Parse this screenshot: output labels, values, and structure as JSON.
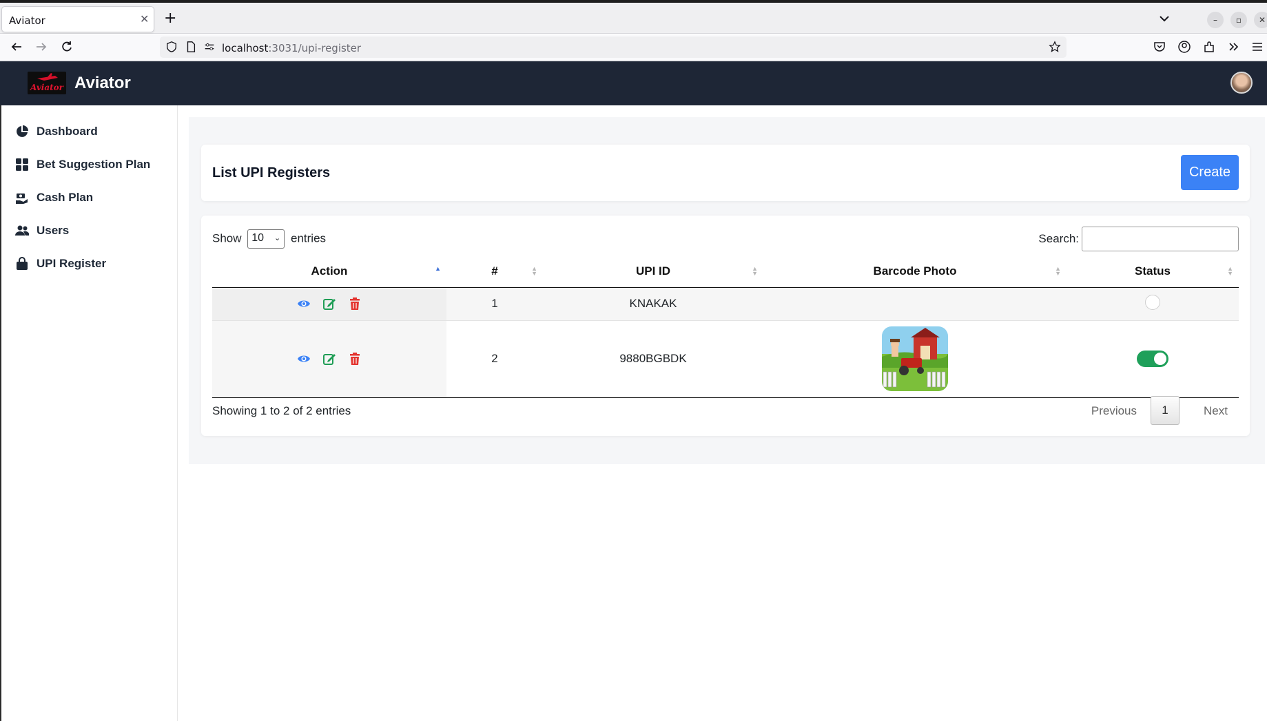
{
  "browser": {
    "tab_title": "Aviator",
    "tab_close": "✕",
    "new_tab": "+",
    "url_host": "localhost",
    "url_path": ":3031/upi-register"
  },
  "app": {
    "title": "Aviator",
    "logo_text": "Aviator"
  },
  "sidebar": {
    "items": [
      {
        "label": "Dashboard",
        "icon": "pie-chart-icon"
      },
      {
        "label": "Bet Suggestion Plan",
        "icon": "grid-icon"
      },
      {
        "label": "Cash Plan",
        "icon": "cash-hand-icon"
      },
      {
        "label": "Users",
        "icon": "users-icon"
      },
      {
        "label": "UPI Register",
        "icon": "bag-icon"
      }
    ]
  },
  "page": {
    "title": "List UPI Registers",
    "create_label": "Create"
  },
  "table": {
    "show_label": "Show",
    "entries_label": "entries",
    "page_size": "10",
    "search_label": "Search:",
    "columns": [
      "Action",
      "#",
      "UPI ID",
      "Barcode Photo",
      "Status"
    ],
    "rows": [
      {
        "num": "1",
        "upi_id": "KNAKAK",
        "has_photo": false,
        "status_on": false
      },
      {
        "num": "2",
        "upi_id": "9880BGBDK",
        "has_photo": true,
        "status_on": true
      }
    ],
    "info": "Showing 1 to 2 of 2 entries",
    "pagination": {
      "previous": "Previous",
      "current": "1",
      "next": "Next"
    }
  },
  "colors": {
    "header_bg": "#1e2636",
    "primary": "#3b82f6",
    "toggle_on": "#1fa05a",
    "view_icon": "#3b82f6",
    "edit_icon": "#1f9d55",
    "delete_icon": "#e3342f"
  }
}
